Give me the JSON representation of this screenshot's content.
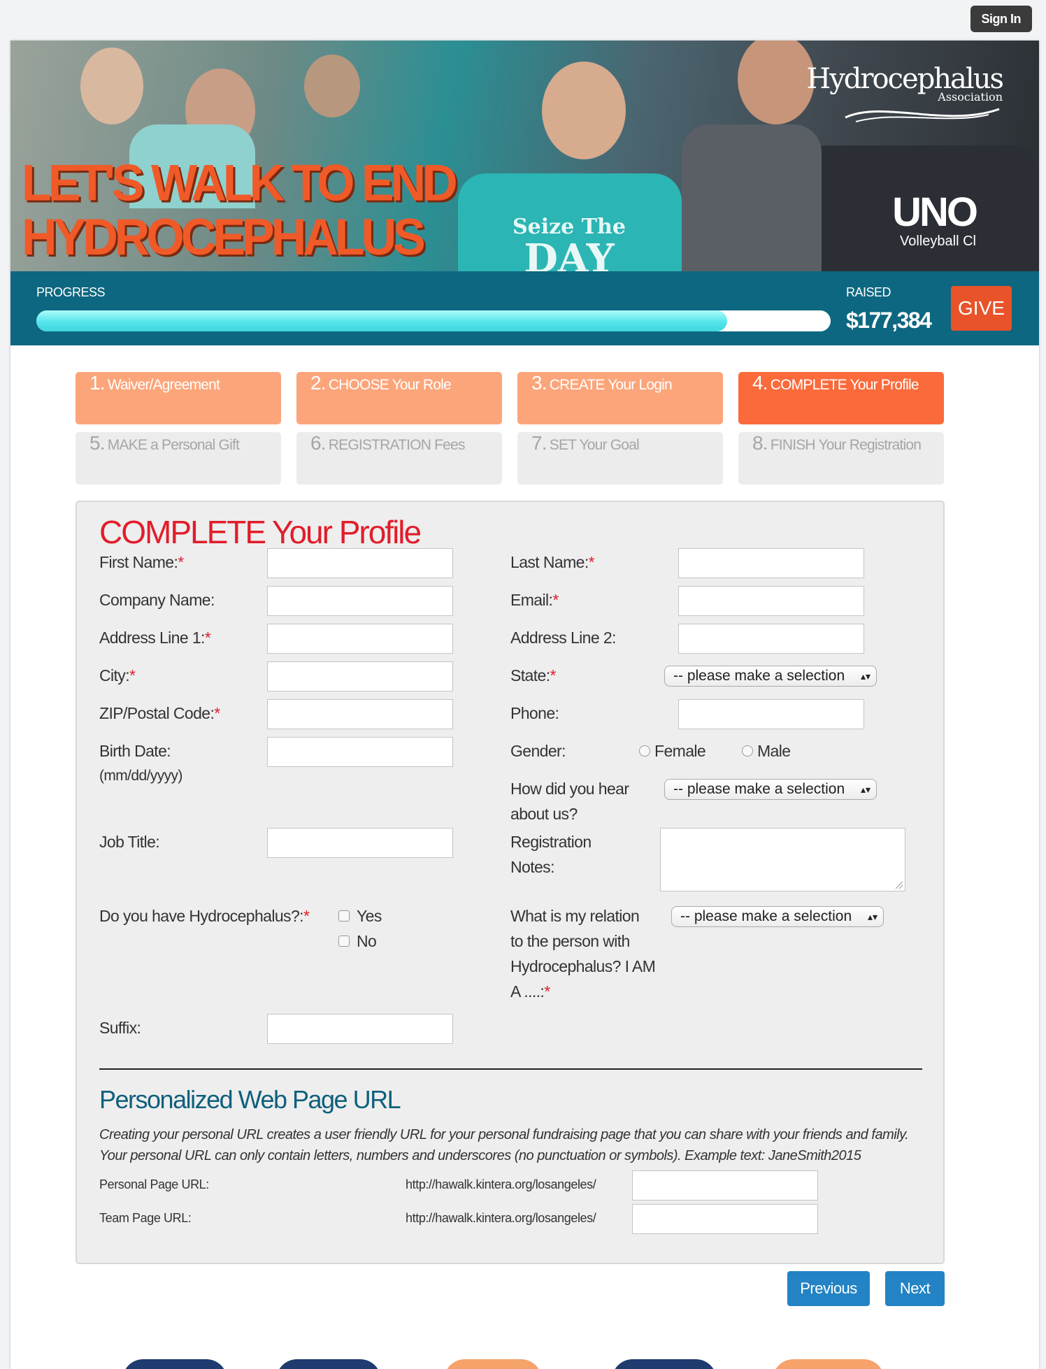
{
  "topbar": {
    "signin_label": "Sign In"
  },
  "hero": {
    "headline_line1": "LET'S WALK TO END",
    "headline_line2": "HYDROCEPHALUS",
    "logo_name": "Hydrocephalus",
    "logo_sub": "Association",
    "shirt_line1": "Seize The",
    "shirt_line2": "DAY",
    "uno_text": "UNO",
    "uno_sub": "Volleyball Cl"
  },
  "progress": {
    "label": "PROGRESS",
    "fraction": 0.87,
    "raised_label": "RAISED",
    "raised_amount": "$177,384",
    "give_label": "GIVE"
  },
  "steps": [
    {
      "num": "1.",
      "label": "Waiver/Agreement",
      "state": "done"
    },
    {
      "num": "2.",
      "label": "CHOOSE Your Role",
      "state": "done"
    },
    {
      "num": "3.",
      "label": "CREATE Your Login",
      "state": "done"
    },
    {
      "num": "4.",
      "label": "COMPLETE Your Profile",
      "state": "current"
    },
    {
      "num": "5.",
      "label": "MAKE a Personal Gift",
      "state": "todo"
    },
    {
      "num": "6.",
      "label": "REGISTRATION Fees",
      "state": "todo"
    },
    {
      "num": "7.",
      "label": "SET Your Goal",
      "state": "todo"
    },
    {
      "num": "8.",
      "label": "FINISH Your Registration",
      "state": "todo"
    }
  ],
  "form": {
    "title": "COMPLETE Your Profile",
    "required_mark": "*",
    "first_name_label": "First Name:",
    "last_name_label": "Last Name:",
    "company_label": "Company Name:",
    "email_label": "Email:",
    "address1_label": "Address Line 1:",
    "address2_label": "Address Line 2:",
    "city_label": "City:",
    "state_label": "State:",
    "zip_label": "ZIP/Postal Code:",
    "phone_label": "Phone:",
    "birth_label": "Birth Date:",
    "birth_hint": "(mm/dd/yyyy)",
    "gender_label": "Gender:",
    "gender_female": "Female",
    "gender_male": "Male",
    "hear_label_1": "How did you hear",
    "hear_label_2": "about us?",
    "job_label": "Job Title:",
    "notes_label_1": "Registration",
    "notes_label_2": "Notes:",
    "hydro_label": "Do you have Hydrocephalus?:",
    "hydro_yes": "Yes",
    "hydro_no": "No",
    "relation_label_1": "What is my relation",
    "relation_label_2": "to the person with",
    "relation_label_3": "Hydrocephalus? I AM",
    "relation_label_4": "A ....:",
    "suffix_label": "Suffix:",
    "select_placeholder": "-- please make a selection"
  },
  "url_section": {
    "title": "Personalized Web Page URL",
    "description": "Creating your personal URL creates a user friendly URL for your personal fundraising page that you can share with your friends and family. Your personal URL can only contain letters, numbers and underscores (no punctuation or symbols). Example text: JaneSmith2015",
    "personal_label": "Personal Page URL:",
    "team_label": "Team Page URL:",
    "url_prefix": "http://hawalk.kintera.org/losangeles/"
  },
  "nav": {
    "previous_label": "Previous",
    "next_label": "Next"
  },
  "colors": {
    "accent_orange": "#fb6a3b",
    "step_done": "#fca57a",
    "band_teal": "#0e6780",
    "required_red": "#e11d2a",
    "button_blue": "#2383c4"
  }
}
